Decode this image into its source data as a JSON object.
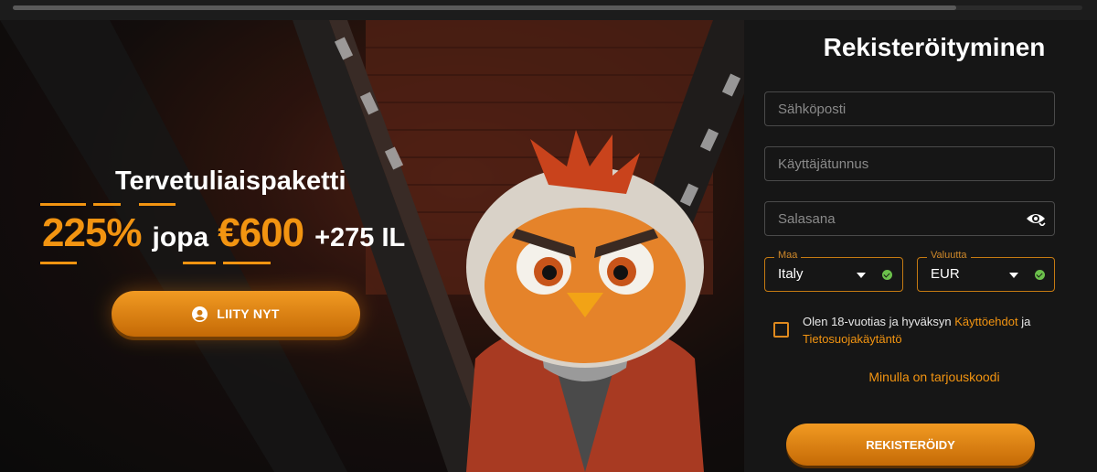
{
  "hero": {
    "title": "Tervetuliaispaketti",
    "percent": "225%",
    "upto": "jopa",
    "amount": "€600",
    "spins": "+275 IL",
    "join_button": "LIITY NYT",
    "join_icon": "user-circle-icon",
    "accent_color": "#f29411"
  },
  "registration": {
    "title": "Rekisteröityminen",
    "email_placeholder": "Sähköposti",
    "username_placeholder": "Käyttäjätunnus",
    "password_placeholder": "Salasana",
    "password_icon": "eye-icon",
    "country": {
      "label": "Maa",
      "value": "Italy"
    },
    "currency": {
      "label": "Valuutta",
      "value": "EUR"
    },
    "terms_prefix": "Olen 18-vuotias ja hyväksyn",
    "terms_link": "Käyttöehdot",
    "terms_and": "ja",
    "privacy_link": "Tietosuojakäytäntö",
    "promo_code_link": "Minulla on tarjouskoodi",
    "register_button": "REKISTERÖIDY"
  }
}
